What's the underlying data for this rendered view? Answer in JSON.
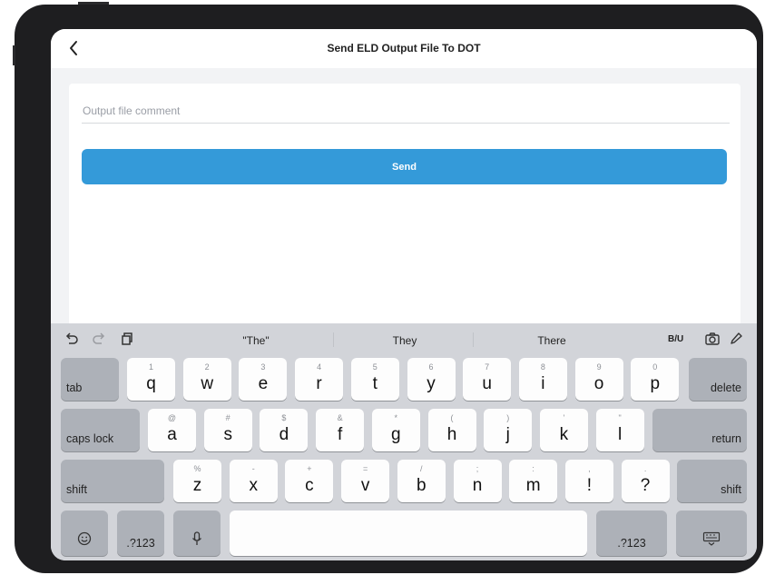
{
  "header": {
    "title": "Send ELD Output File To DOT"
  },
  "form": {
    "comment_placeholder": "Output file comment",
    "comment_value": "",
    "send_label": "Send"
  },
  "keyboard": {
    "suggestions": [
      "\"The\"",
      "They",
      "There"
    ],
    "format_label": "B/U",
    "row1": [
      {
        "char": "q",
        "sub": "1"
      },
      {
        "char": "w",
        "sub": "2"
      },
      {
        "char": "e",
        "sub": "3"
      },
      {
        "char": "r",
        "sub": "4"
      },
      {
        "char": "t",
        "sub": "5"
      },
      {
        "char": "y",
        "sub": "6"
      },
      {
        "char": "u",
        "sub": "7"
      },
      {
        "char": "i",
        "sub": "8"
      },
      {
        "char": "o",
        "sub": "9"
      },
      {
        "char": "p",
        "sub": "0"
      }
    ],
    "row2": [
      {
        "char": "a",
        "sub": "@"
      },
      {
        "char": "s",
        "sub": "#"
      },
      {
        "char": "d",
        "sub": "$"
      },
      {
        "char": "f",
        "sub": "&"
      },
      {
        "char": "g",
        "sub": "*"
      },
      {
        "char": "h",
        "sub": "("
      },
      {
        "char": "j",
        "sub": ")"
      },
      {
        "char": "k",
        "sub": "'"
      },
      {
        "char": "l",
        "sub": "\""
      }
    ],
    "row3": [
      {
        "char": "z",
        "sub": "%"
      },
      {
        "char": "x",
        "sub": "-"
      },
      {
        "char": "c",
        "sub": "+"
      },
      {
        "char": "v",
        "sub": "="
      },
      {
        "char": "b",
        "sub": "/"
      },
      {
        "char": "n",
        "sub": ";"
      },
      {
        "char": "m",
        "sub": ":"
      },
      {
        "char": "!",
        "sub": ","
      },
      {
        "char": "?",
        "sub": "."
      }
    ],
    "tab_label": "tab",
    "delete_label": "delete",
    "caps_label": "caps lock",
    "return_label": "return",
    "shift_label": "shift",
    "numbers_label": ".?123"
  },
  "colors": {
    "accent": "#349ad9",
    "keyboard_bg": "#d2d4d9",
    "device": "#1e1e20"
  }
}
